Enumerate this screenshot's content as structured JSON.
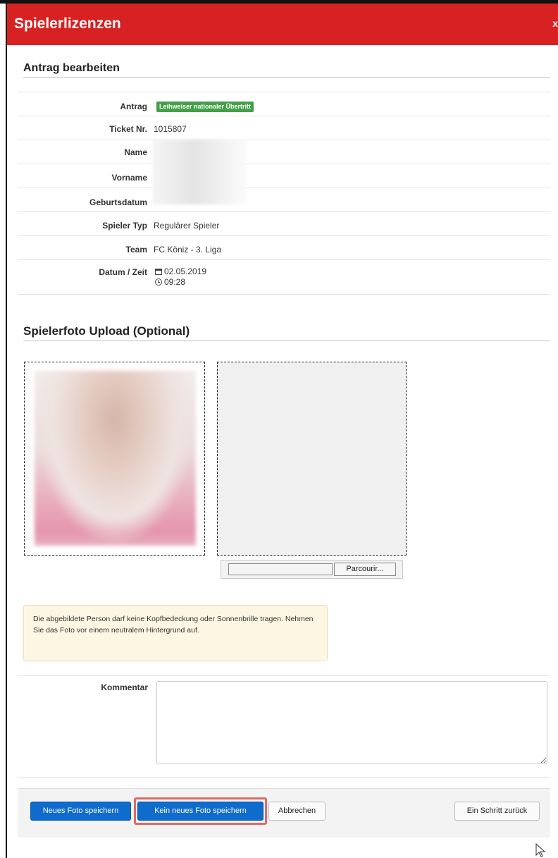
{
  "dialog": {
    "title": "Spielerlizenzen",
    "close_label": "x"
  },
  "section_request": {
    "heading": "Antrag bearbeiten",
    "rows": {
      "antrag": {
        "label": "Antrag",
        "badge": "Leihweiser nationaler Übertritt",
        "badge_color": "#43a047"
      },
      "ticket": {
        "label": "Ticket Nr.",
        "value": "1015807"
      },
      "name": {
        "label": "Name",
        "value": ""
      },
      "vorname": {
        "label": "Vorname",
        "value": ""
      },
      "geburtsdatum": {
        "label": "Geburtsdatum",
        "value": ""
      },
      "spieler_typ": {
        "label": "Spieler Typ",
        "value": "Regulärer Spieler"
      },
      "team": {
        "label": "Team",
        "value": "FC Köniz - 3. Liga"
      },
      "datum_zeit": {
        "label": "Datum / Zeit",
        "date": "02.05.2019",
        "time": "09:28",
        "date_icon": "calendar-icon",
        "time_icon": "clock-icon"
      }
    }
  },
  "section_photo": {
    "heading": "Spielerfoto Upload (Optional)",
    "browse_label": "Parcourir...",
    "notice": "Die abgebildete Person darf keine Kopfbedeckung oder Sonnenbrille tragen. Nehmen Sie das Foto vor einem neutralem Hintergrund auf."
  },
  "comment": {
    "label": "Kommentar",
    "value": ""
  },
  "footer": {
    "save_new_photo": "Neues Foto speichern",
    "save_no_new_photo": "Kein neues Foto speichern",
    "cancel": "Abbrechen",
    "back": "Ein Schritt zurück"
  },
  "colors": {
    "header": "#d72122",
    "primary_button": "#0f6ccc",
    "highlight": "#e06a64"
  }
}
